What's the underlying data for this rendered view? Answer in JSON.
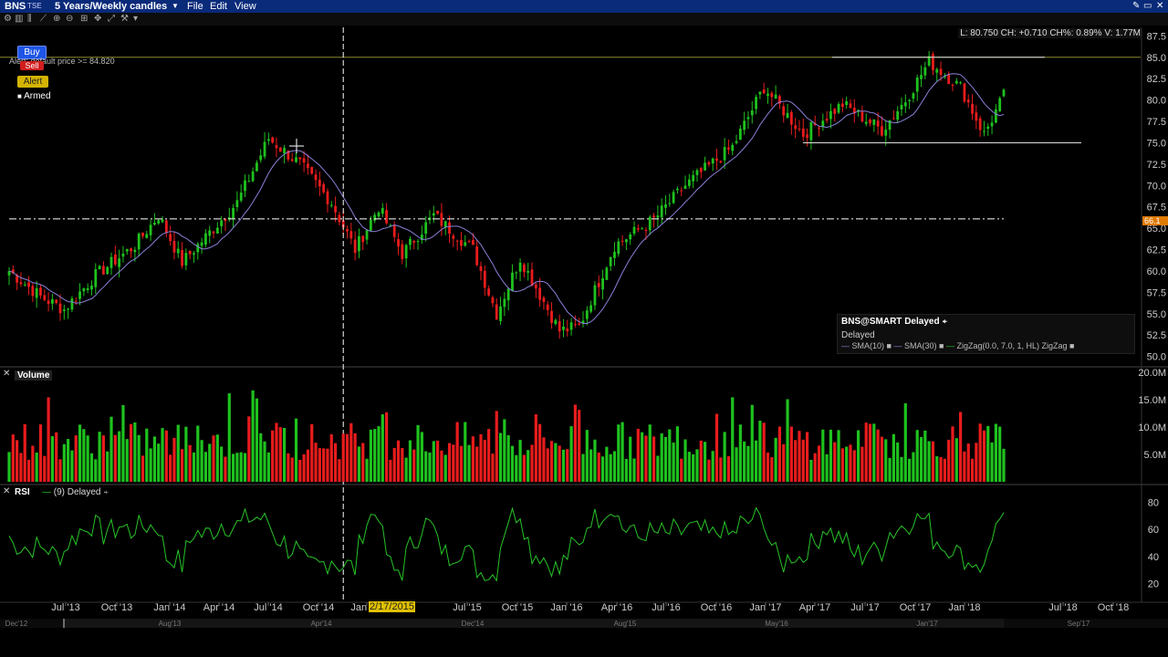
{
  "window": {
    "symbol": "BNS",
    "exchange": "TSE",
    "period": "5 Years/Weekly candles",
    "menu": [
      "File",
      "Edit",
      "View"
    ]
  },
  "order_panel": {
    "buy_label": "Buy",
    "sell_label": "Sell",
    "alert_label": "Alert",
    "armed_label": "Armed",
    "alert_text": "Alert: default price >= 84.820"
  },
  "readout": {
    "text": "L: 80.750 CH: +0.710 CH%: 0.89% V: 1.77M"
  },
  "legend": {
    "title": "BNS@SMART Delayed",
    "status": "Delayed",
    "items": [
      "SMA(10)",
      "SMA(30)",
      "ZigZag(0.0, 7.0, 1, HL) ZigZag"
    ]
  },
  "cursor_label": "2/17/2015",
  "current_price_tag": "66.1",
  "colors": {
    "up": "#1ec21e",
    "down": "#e81c1c",
    "sma": "#8a80d8",
    "rsi": "#27c427",
    "crosshair": "#ffffff",
    "grid_line": "#8a8a30"
  },
  "chart_data": [
    {
      "type": "candlestick",
      "title": "BNS",
      "y_ticks": [
        "87.5",
        "85.0",
        "82.5",
        "80.0",
        "77.5",
        "75.0",
        "72.5",
        "70.0",
        "67.5",
        "65.0",
        "62.5",
        "60.0",
        "57.5",
        "55.0",
        "52.5",
        "50.0"
      ],
      "ylim": [
        49,
        88.5
      ],
      "x_tick_labels": [
        "Jul '13",
        "Oct '13",
        "Jan '14",
        "Apr '14",
        "Jul '14",
        "Oct '14",
        "Jan '15",
        "Jul '15",
        "Oct '15",
        "Jan '16",
        "Apr '16",
        "Jul '16",
        "Oct '16",
        "Jan '17",
        "Apr '17",
        "Jul '17",
        "Oct '17",
        "Jan '18",
        "Jul '18",
        "Oct '18"
      ],
      "overview_labels": [
        "Dec'12",
        "Aug'13",
        "Apr'14",
        "Dec'14",
        "Aug'15",
        "May'16",
        "Jan'17",
        "Sep'17"
      ],
      "close_anchors": [
        {
          "week": 0,
          "close": 60.0
        },
        {
          "week": 8,
          "close": 57.0
        },
        {
          "week": 14,
          "close": 55.5
        },
        {
          "week": 22,
          "close": 59.5
        },
        {
          "week": 32,
          "close": 63.0
        },
        {
          "week": 38,
          "close": 66.5
        },
        {
          "week": 44,
          "close": 61.0
        },
        {
          "week": 58,
          "close": 68.0
        },
        {
          "week": 66,
          "close": 75.5
        },
        {
          "week": 74,
          "close": 72.5
        },
        {
          "week": 82,
          "close": 68.0
        },
        {
          "week": 88,
          "close": 62.5
        },
        {
          "week": 94,
          "close": 67.5
        },
        {
          "week": 100,
          "close": 62.0
        },
        {
          "week": 108,
          "close": 66.5
        },
        {
          "week": 118,
          "close": 62.5
        },
        {
          "week": 124,
          "close": 55.0
        },
        {
          "week": 130,
          "close": 61.5
        },
        {
          "week": 140,
          "close": 53.0
        },
        {
          "week": 145,
          "close": 53.5
        },
        {
          "week": 154,
          "close": 63.0
        },
        {
          "week": 164,
          "close": 66.0
        },
        {
          "week": 172,
          "close": 70.0
        },
        {
          "week": 184,
          "close": 74.5
        },
        {
          "week": 192,
          "close": 81.5
        },
        {
          "week": 202,
          "close": 76.0
        },
        {
          "week": 212,
          "close": 79.5
        },
        {
          "week": 222,
          "close": 76.5
        },
        {
          "week": 228,
          "close": 80.0
        },
        {
          "week": 234,
          "close": 84.5
        },
        {
          "week": 242,
          "close": 81.5
        },
        {
          "week": 248,
          "close": 76.0
        },
        {
          "week": 253,
          "close": 80.5
        }
      ],
      "series": [
        {
          "name": "SMA(10)"
        },
        {
          "name": "SMA(30)"
        }
      ],
      "horizontal_lines": [
        85.0,
        75.0,
        66.1
      ],
      "visible_range_weeks": [
        0,
        253
      ]
    },
    {
      "type": "bar",
      "title": "Volume",
      "y_ticks": [
        "20.0M",
        "15.0M",
        "10.0M",
        "5.0M"
      ],
      "ylim": [
        0,
        20.5
      ]
    },
    {
      "type": "line",
      "title": "RSI",
      "subtitle": "(9) Delayed",
      "y_ticks": [
        "80",
        "60",
        "40",
        "20"
      ],
      "ylim": [
        8,
        92
      ]
    }
  ]
}
